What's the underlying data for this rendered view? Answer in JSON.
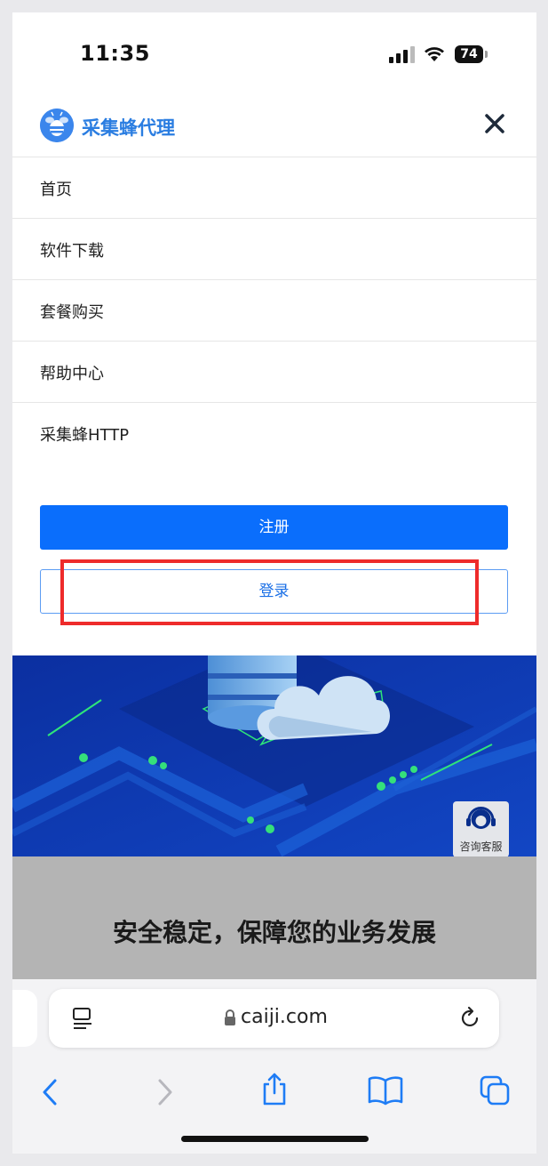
{
  "status_bar": {
    "time": "11:35",
    "battery": "74"
  },
  "header": {
    "brand": "采集蜂代理"
  },
  "menu": {
    "items": [
      {
        "label": "首页"
      },
      {
        "label": "软件下载"
      },
      {
        "label": "套餐购买"
      },
      {
        "label": "帮助中心"
      },
      {
        "label": "采集蜂HTTP"
      }
    ]
  },
  "buttons": {
    "register": "注册",
    "login": "登录"
  },
  "support": {
    "label": "咨询客服"
  },
  "section": {
    "tagline": "安全稳定，保障您的业务发展"
  },
  "browser": {
    "url": "caiji.com"
  },
  "colors": {
    "accent": "#0a6efc",
    "brand": "#2a7de1",
    "banner": "#0c3ab0",
    "highlight": "#ee2b2b"
  }
}
